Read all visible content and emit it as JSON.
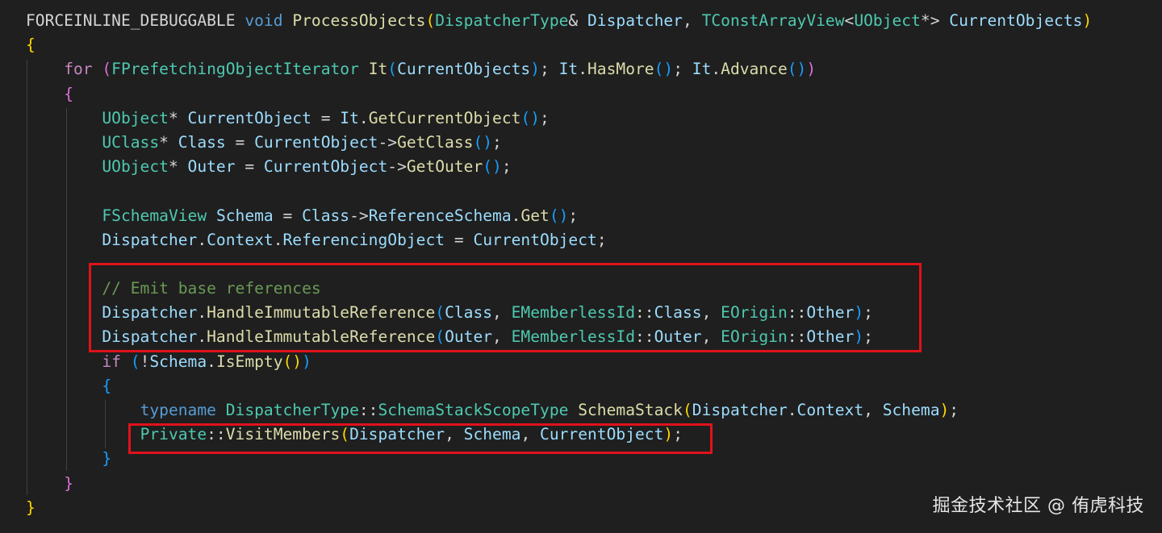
{
  "editor": {
    "theme": {
      "background": "#1f1f1f",
      "highlight_box_color": "#e0121b"
    },
    "token_colors": {
      "plain": "#d4d4d4",
      "keyword": "#569cd6",
      "control": "#c586c0",
      "type": "#4ec9b0",
      "function": "#dcdcaa",
      "variable": "#9cdcfe",
      "comment": "#6a9955",
      "bracket1": "#ffd700",
      "bracket2": "#da70d6",
      "bracket3": "#179fff"
    },
    "lines": [
      [
        {
          "t": "FORCEINLINE_DEBUGGABLE ",
          "c": "plain"
        },
        {
          "t": "void",
          "c": "keyword"
        },
        {
          "t": " ",
          "c": "plain"
        },
        {
          "t": "ProcessObjects",
          "c": "function"
        },
        {
          "t": "(",
          "c": "bracket1"
        },
        {
          "t": "DispatcherType",
          "c": "type"
        },
        {
          "t": "& ",
          "c": "plain"
        },
        {
          "t": "Dispatcher",
          "c": "variable"
        },
        {
          "t": ", ",
          "c": "plain"
        },
        {
          "t": "TConstArrayView",
          "c": "type"
        },
        {
          "t": "<",
          "c": "plain"
        },
        {
          "t": "UObject",
          "c": "type"
        },
        {
          "t": "*> ",
          "c": "plain"
        },
        {
          "t": "CurrentObjects",
          "c": "variable"
        },
        {
          "t": ")",
          "c": "bracket1"
        }
      ],
      [
        {
          "t": "{",
          "c": "bracket1"
        }
      ],
      [
        {
          "t": "    ",
          "c": "plain"
        },
        {
          "t": "for",
          "c": "control"
        },
        {
          "t": " ",
          "c": "plain"
        },
        {
          "t": "(",
          "c": "bracket2"
        },
        {
          "t": "FPrefetchingObjectIterator",
          "c": "type"
        },
        {
          "t": " ",
          "c": "plain"
        },
        {
          "t": "It",
          "c": "function"
        },
        {
          "t": "(",
          "c": "bracket3"
        },
        {
          "t": "CurrentObjects",
          "c": "variable"
        },
        {
          "t": ")",
          "c": "bracket3"
        },
        {
          "t": "; ",
          "c": "plain"
        },
        {
          "t": "It",
          "c": "variable"
        },
        {
          "t": ".",
          "c": "plain"
        },
        {
          "t": "HasMore",
          "c": "function"
        },
        {
          "t": "()",
          "c": "bracket3"
        },
        {
          "t": "; ",
          "c": "plain"
        },
        {
          "t": "It",
          "c": "variable"
        },
        {
          "t": ".",
          "c": "plain"
        },
        {
          "t": "Advance",
          "c": "function"
        },
        {
          "t": "()",
          "c": "bracket3"
        },
        {
          "t": ")",
          "c": "bracket2"
        }
      ],
      [
        {
          "t": "    ",
          "c": "plain"
        },
        {
          "t": "{",
          "c": "bracket2"
        }
      ],
      [
        {
          "t": "        ",
          "c": "plain"
        },
        {
          "t": "UObject",
          "c": "type"
        },
        {
          "t": "* ",
          "c": "plain"
        },
        {
          "t": "CurrentObject",
          "c": "variable"
        },
        {
          "t": " = ",
          "c": "plain"
        },
        {
          "t": "It",
          "c": "variable"
        },
        {
          "t": ".",
          "c": "plain"
        },
        {
          "t": "GetCurrentObject",
          "c": "function"
        },
        {
          "t": "()",
          "c": "bracket3"
        },
        {
          "t": ";",
          "c": "plain"
        }
      ],
      [
        {
          "t": "        ",
          "c": "plain"
        },
        {
          "t": "UClass",
          "c": "type"
        },
        {
          "t": "* ",
          "c": "plain"
        },
        {
          "t": "Class",
          "c": "variable"
        },
        {
          "t": " = ",
          "c": "plain"
        },
        {
          "t": "CurrentObject",
          "c": "variable"
        },
        {
          "t": "->",
          "c": "plain"
        },
        {
          "t": "GetClass",
          "c": "function"
        },
        {
          "t": "()",
          "c": "bracket3"
        },
        {
          "t": ";",
          "c": "plain"
        }
      ],
      [
        {
          "t": "        ",
          "c": "plain"
        },
        {
          "t": "UObject",
          "c": "type"
        },
        {
          "t": "* ",
          "c": "plain"
        },
        {
          "t": "Outer",
          "c": "variable"
        },
        {
          "t": " = ",
          "c": "plain"
        },
        {
          "t": "CurrentObject",
          "c": "variable"
        },
        {
          "t": "->",
          "c": "plain"
        },
        {
          "t": "GetOuter",
          "c": "function"
        },
        {
          "t": "()",
          "c": "bracket3"
        },
        {
          "t": ";",
          "c": "plain"
        }
      ],
      [],
      [
        {
          "t": "        ",
          "c": "plain"
        },
        {
          "t": "FSchemaView",
          "c": "type"
        },
        {
          "t": " ",
          "c": "plain"
        },
        {
          "t": "Schema",
          "c": "variable"
        },
        {
          "t": " = ",
          "c": "plain"
        },
        {
          "t": "Class",
          "c": "variable"
        },
        {
          "t": "->",
          "c": "plain"
        },
        {
          "t": "ReferenceSchema",
          "c": "variable"
        },
        {
          "t": ".",
          "c": "plain"
        },
        {
          "t": "Get",
          "c": "function"
        },
        {
          "t": "()",
          "c": "bracket3"
        },
        {
          "t": ";",
          "c": "plain"
        }
      ],
      [
        {
          "t": "        ",
          "c": "plain"
        },
        {
          "t": "Dispatcher",
          "c": "variable"
        },
        {
          "t": ".",
          "c": "plain"
        },
        {
          "t": "Context",
          "c": "variable"
        },
        {
          "t": ".",
          "c": "plain"
        },
        {
          "t": "ReferencingObject",
          "c": "variable"
        },
        {
          "t": " = ",
          "c": "plain"
        },
        {
          "t": "CurrentObject",
          "c": "variable"
        },
        {
          "t": ";",
          "c": "plain"
        }
      ],
      [],
      [
        {
          "t": "        ",
          "c": "plain"
        },
        {
          "t": "// Emit base references",
          "c": "comment"
        }
      ],
      [
        {
          "t": "        ",
          "c": "plain"
        },
        {
          "t": "Dispatcher",
          "c": "variable"
        },
        {
          "t": ".",
          "c": "plain"
        },
        {
          "t": "HandleImmutableReference",
          "c": "function"
        },
        {
          "t": "(",
          "c": "bracket3"
        },
        {
          "t": "Class",
          "c": "variable"
        },
        {
          "t": ", ",
          "c": "plain"
        },
        {
          "t": "EMemberlessId",
          "c": "type"
        },
        {
          "t": "::",
          "c": "plain"
        },
        {
          "t": "Class",
          "c": "variable"
        },
        {
          "t": ", ",
          "c": "plain"
        },
        {
          "t": "EOrigin",
          "c": "type"
        },
        {
          "t": "::",
          "c": "plain"
        },
        {
          "t": "Other",
          "c": "variable"
        },
        {
          "t": ")",
          "c": "bracket3"
        },
        {
          "t": ";",
          "c": "plain"
        }
      ],
      [
        {
          "t": "        ",
          "c": "plain"
        },
        {
          "t": "Dispatcher",
          "c": "variable"
        },
        {
          "t": ".",
          "c": "plain"
        },
        {
          "t": "HandleImmutableReference",
          "c": "function"
        },
        {
          "t": "(",
          "c": "bracket3"
        },
        {
          "t": "Outer",
          "c": "variable"
        },
        {
          "t": ", ",
          "c": "plain"
        },
        {
          "t": "EMemberlessId",
          "c": "type"
        },
        {
          "t": "::",
          "c": "plain"
        },
        {
          "t": "Outer",
          "c": "variable"
        },
        {
          "t": ", ",
          "c": "plain"
        },
        {
          "t": "EOrigin",
          "c": "type"
        },
        {
          "t": "::",
          "c": "plain"
        },
        {
          "t": "Other",
          "c": "variable"
        },
        {
          "t": ")",
          "c": "bracket3"
        },
        {
          "t": ";",
          "c": "plain"
        }
      ],
      [
        {
          "t": "        ",
          "c": "plain"
        },
        {
          "t": "if",
          "c": "control"
        },
        {
          "t": " ",
          "c": "plain"
        },
        {
          "t": "(",
          "c": "bracket3"
        },
        {
          "t": "!",
          "c": "plain"
        },
        {
          "t": "Schema",
          "c": "variable"
        },
        {
          "t": ".",
          "c": "plain"
        },
        {
          "t": "IsEmpty",
          "c": "function"
        },
        {
          "t": "()",
          "c": "bracket1"
        },
        {
          "t": ")",
          "c": "bracket3"
        }
      ],
      [
        {
          "t": "        ",
          "c": "plain"
        },
        {
          "t": "{",
          "c": "bracket3"
        }
      ],
      [
        {
          "t": "            ",
          "c": "plain"
        },
        {
          "t": "typename",
          "c": "keyword"
        },
        {
          "t": " ",
          "c": "plain"
        },
        {
          "t": "DispatcherType",
          "c": "type"
        },
        {
          "t": "::",
          "c": "plain"
        },
        {
          "t": "SchemaStackScopeType",
          "c": "type"
        },
        {
          "t": " ",
          "c": "plain"
        },
        {
          "t": "SchemaStack",
          "c": "function"
        },
        {
          "t": "(",
          "c": "bracket1"
        },
        {
          "t": "Dispatcher",
          "c": "variable"
        },
        {
          "t": ".",
          "c": "plain"
        },
        {
          "t": "Context",
          "c": "variable"
        },
        {
          "t": ", ",
          "c": "plain"
        },
        {
          "t": "Schema",
          "c": "variable"
        },
        {
          "t": ")",
          "c": "bracket1"
        },
        {
          "t": ";",
          "c": "plain"
        }
      ],
      [
        {
          "t": "            ",
          "c": "plain"
        },
        {
          "t": "Private",
          "c": "type"
        },
        {
          "t": "::",
          "c": "plain"
        },
        {
          "t": "VisitMembers",
          "c": "function"
        },
        {
          "t": "(",
          "c": "bracket1"
        },
        {
          "t": "Dispatcher",
          "c": "variable"
        },
        {
          "t": ", ",
          "c": "plain"
        },
        {
          "t": "Schema",
          "c": "variable"
        },
        {
          "t": ", ",
          "c": "plain"
        },
        {
          "t": "CurrentObject",
          "c": "variable"
        },
        {
          "t": ")",
          "c": "bracket1"
        },
        {
          "t": ";",
          "c": "plain"
        }
      ],
      [
        {
          "t": "        ",
          "c": "plain"
        },
        {
          "t": "}",
          "c": "bracket3"
        }
      ],
      [
        {
          "t": "    ",
          "c": "plain"
        },
        {
          "t": "}",
          "c": "bracket2"
        }
      ],
      [
        {
          "t": "}",
          "c": "bracket1"
        }
      ]
    ]
  },
  "watermark": {
    "text": "掘金技术社区 @ 侑虎科技"
  }
}
